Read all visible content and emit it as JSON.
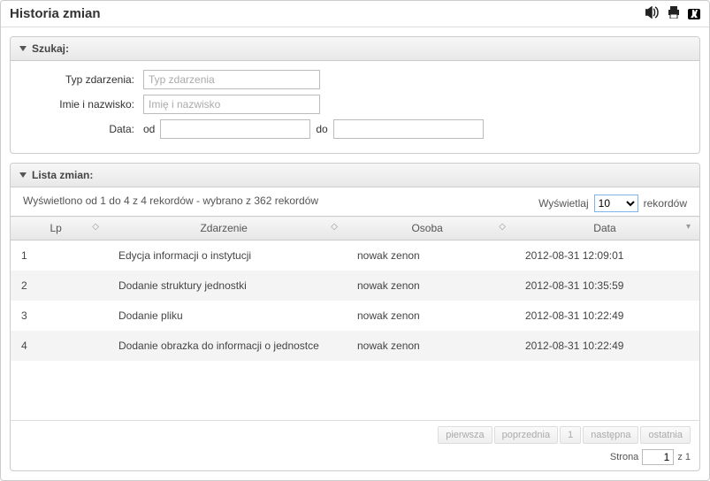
{
  "window": {
    "title": "Historia zmian"
  },
  "search": {
    "panel_title": "Szukaj:",
    "type_label": "Typ zdarzenia:",
    "type_placeholder": "Typ zdarzenia",
    "name_label": "Imie i nazwisko:",
    "name_placeholder": "Imię i nazwisko",
    "date_label": "Data:",
    "from_label": "od",
    "to_label": "do"
  },
  "list": {
    "panel_title": "Lista zmian:",
    "records_info": "Wyświetlono od 1 do 4 z 4 rekordów - wybrano z 362 rekordów",
    "display_label_left": "Wyświetlaj",
    "display_label_right": "rekordów",
    "per_page": "10",
    "columns": {
      "lp": "Lp",
      "event": "Zdarzenie",
      "person": "Osoba",
      "date": "Data"
    },
    "rows": [
      {
        "lp": "1",
        "event": "Edycja informacji o instytucji",
        "person": "nowak zenon",
        "date": "2012-08-31 12:09:01"
      },
      {
        "lp": "2",
        "event": "Dodanie struktury jednostki",
        "person": "nowak zenon",
        "date": "2012-08-31 10:35:59"
      },
      {
        "lp": "3",
        "event": "Dodanie pliku",
        "person": "nowak zenon",
        "date": "2012-08-31 10:22:49"
      },
      {
        "lp": "4",
        "event": "Dodanie obrazka do informacji o jednostce",
        "person": "nowak zenon",
        "date": "2012-08-31 10:22:49"
      }
    ],
    "pager": {
      "first": "pierwsza",
      "prev": "poprzednia",
      "page": "1",
      "next": "następna",
      "last": "ostatnia",
      "page_label": "Strona",
      "page_value": "1",
      "of_label": "z 1"
    }
  }
}
